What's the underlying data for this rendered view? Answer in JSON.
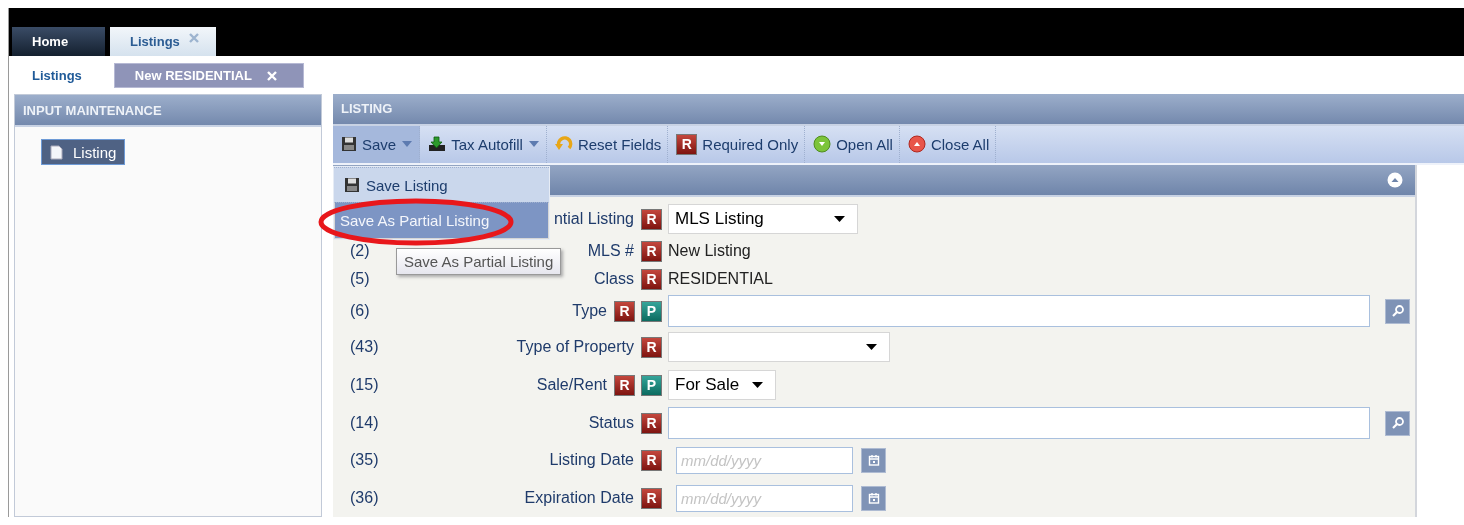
{
  "top_tabs": [
    {
      "label": "Home",
      "selected": false,
      "closable": false
    },
    {
      "label": "Listings",
      "selected": true,
      "closable": true
    }
  ],
  "sub_tabs": [
    {
      "label": "Listings",
      "selected": false,
      "closable": false
    },
    {
      "label": "New RESIDENTIAL",
      "selected": true,
      "closable": true
    }
  ],
  "sidebar": {
    "title": "INPUT MAINTENANCE",
    "items": [
      {
        "label": "Listing",
        "selected": true
      }
    ]
  },
  "listing": {
    "title": "LISTING",
    "toolbar": [
      {
        "label": "Save",
        "kind": "dropdown",
        "pressed": true
      },
      {
        "label": "Tax Autofill",
        "kind": "dropdown",
        "pressed": false
      },
      {
        "label": "Reset Fields",
        "kind": "button",
        "pressed": false
      },
      {
        "label": "Required Only",
        "kind": "badge",
        "badge": "R",
        "pressed": false
      },
      {
        "label": "Open All",
        "kind": "button",
        "pressed": false
      },
      {
        "label": "Close All",
        "kind": "button",
        "pressed": false
      }
    ],
    "save_menu": [
      {
        "label": "Save Listing",
        "selected": false
      },
      {
        "label": "Save As Partial Listing",
        "selected": true
      }
    ],
    "tooltip": "Save As Partial Listing",
    "section": {
      "expanded": true,
      "rows": [
        {
          "label": "ntial Listing",
          "badges": [
            "R"
          ],
          "kind": "select",
          "value": "MLS Listing"
        },
        {
          "number": "(2)",
          "label": "MLS #",
          "badges": [
            "R"
          ],
          "kind": "text",
          "value": "New Listing"
        },
        {
          "number": "(5)",
          "label": "Class",
          "badges": [
            "R"
          ],
          "kind": "text",
          "value": "RESIDENTIAL"
        },
        {
          "number": "(6)",
          "label": "Type",
          "badges": [
            "R",
            "P"
          ],
          "kind": "lookup"
        },
        {
          "number": "(43)",
          "label": "Type of Property",
          "badges": [
            "R"
          ],
          "kind": "select"
        },
        {
          "number": "(15)",
          "label": "Sale/Rent",
          "badges": [
            "R",
            "P"
          ],
          "kind": "smallselect",
          "value": "For Sale"
        },
        {
          "number": "(14)",
          "label": "Status",
          "badges": [
            "R"
          ],
          "kind": "lookup"
        },
        {
          "number": "(35)",
          "label": "Listing Date",
          "badges": [
            "R"
          ],
          "kind": "date",
          "placeholder": "mm/dd/yyyy"
        },
        {
          "number": "(36)",
          "label": "Expiration Date",
          "badges": [
            "R"
          ],
          "kind": "date",
          "placeholder": "mm/dd/yyyy"
        }
      ]
    }
  }
}
